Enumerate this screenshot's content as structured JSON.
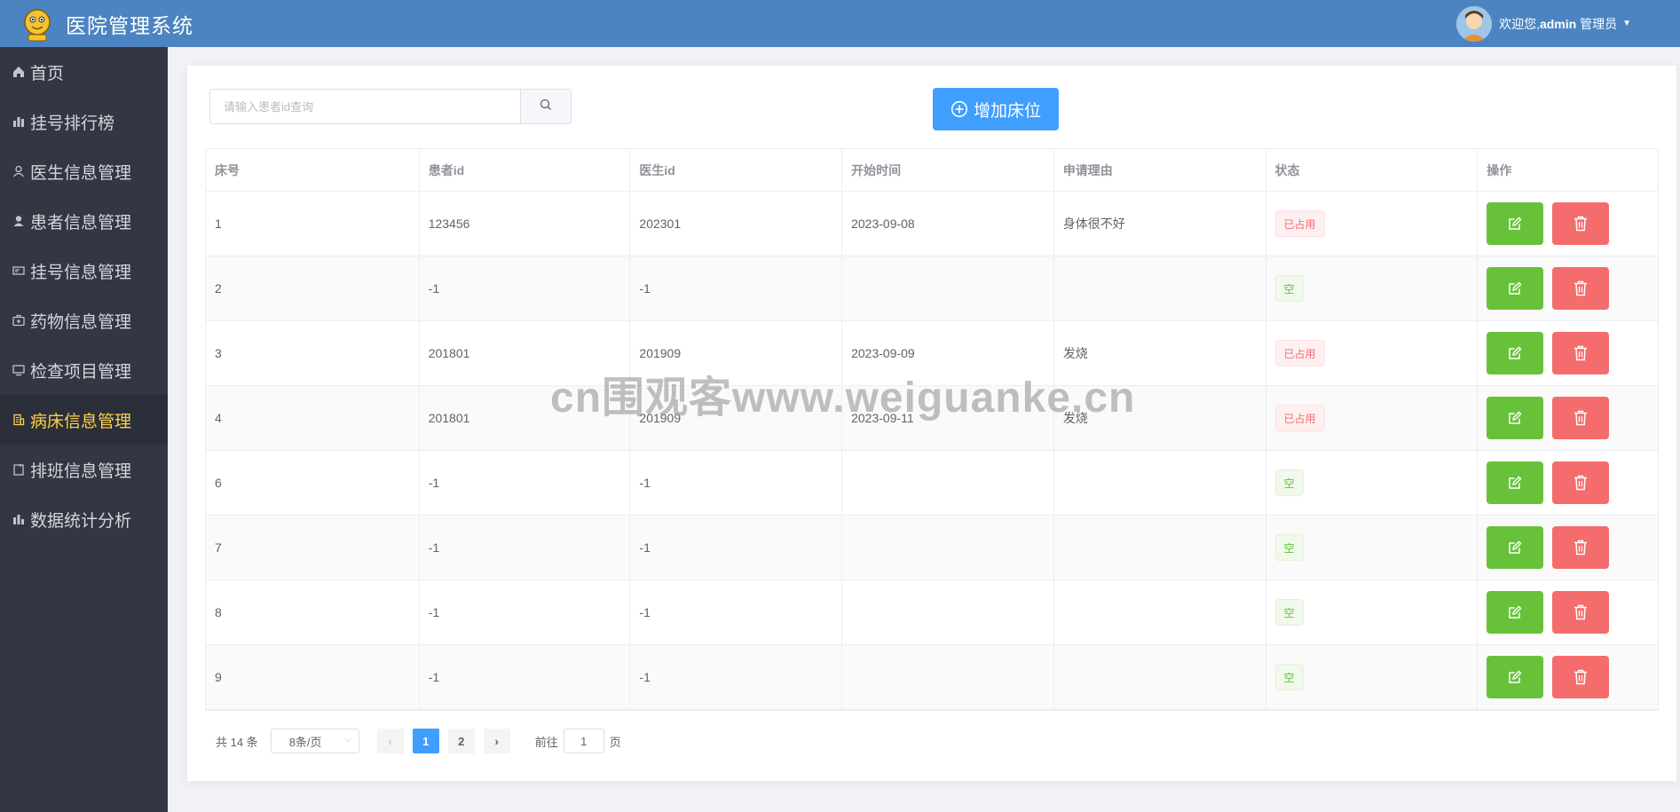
{
  "header": {
    "title": "医院管理系统",
    "welcome_prefix": "欢迎您,",
    "username": "admin",
    "role": "管理员"
  },
  "sidebar": {
    "items": [
      {
        "label": "首页",
        "icon": "home-icon",
        "active": false
      },
      {
        "label": "挂号排行榜",
        "icon": "bar-chart-icon",
        "active": false
      },
      {
        "label": "医生信息管理",
        "icon": "user-outline-icon",
        "active": false
      },
      {
        "label": "患者信息管理",
        "icon": "user-solid-icon",
        "active": false
      },
      {
        "label": "挂号信息管理",
        "icon": "ticket-icon",
        "active": false
      },
      {
        "label": "药物信息管理",
        "icon": "first-aid-icon",
        "active": false
      },
      {
        "label": "检查项目管理",
        "icon": "monitor-icon",
        "active": false
      },
      {
        "label": "病床信息管理",
        "icon": "office-building-icon",
        "active": true
      },
      {
        "label": "排班信息管理",
        "icon": "notebook-icon",
        "active": false
      },
      {
        "label": "数据统计分析",
        "icon": "stats-icon",
        "active": false
      }
    ]
  },
  "search": {
    "placeholder": "请输入患者id查询"
  },
  "add_button": {
    "label": "增加床位"
  },
  "table": {
    "headers": [
      "床号",
      "患者id",
      "医生id",
      "开始时间",
      "申请理由",
      "状态",
      "操作"
    ],
    "rows": [
      {
        "bed": "1",
        "patient_id": "123456",
        "doctor_id": "202301",
        "start": "2023-09-08",
        "reason": "身体很不好",
        "status": "已占用",
        "status_type": "danger"
      },
      {
        "bed": "2",
        "patient_id": "-1",
        "doctor_id": "-1",
        "start": "",
        "reason": "",
        "status": "空",
        "status_type": "success"
      },
      {
        "bed": "3",
        "patient_id": "201801",
        "doctor_id": "201909",
        "start": "2023-09-09",
        "reason": "发烧",
        "status": "已占用",
        "status_type": "danger"
      },
      {
        "bed": "4",
        "patient_id": "201801",
        "doctor_id": "201909",
        "start": "2023-09-11",
        "reason": "发烧",
        "status": "已占用",
        "status_type": "danger"
      },
      {
        "bed": "6",
        "patient_id": "-1",
        "doctor_id": "-1",
        "start": "",
        "reason": "",
        "status": "空",
        "status_type": "success"
      },
      {
        "bed": "7",
        "patient_id": "-1",
        "doctor_id": "-1",
        "start": "",
        "reason": "",
        "status": "空",
        "status_type": "success"
      },
      {
        "bed": "8",
        "patient_id": "-1",
        "doctor_id": "-1",
        "start": "",
        "reason": "",
        "status": "空",
        "status_type": "success"
      },
      {
        "bed": "9",
        "patient_id": "-1",
        "doctor_id": "-1",
        "start": "",
        "reason": "",
        "status": "空",
        "status_type": "success"
      }
    ]
  },
  "pagination": {
    "total_text": "共 14 条",
    "page_size": "8条/页",
    "pages": [
      "1",
      "2"
    ],
    "current_page": "1",
    "goto_label": "前往",
    "goto_value": "1",
    "goto_suffix": "页"
  },
  "watermark": "cn围观客www.weiguanke.cn",
  "colors": {
    "header_bg": "#4b84c0",
    "sidebar_bg": "#333744",
    "active_menu": "#ffd04b",
    "primary": "#409eff",
    "success": "#67c23a",
    "danger": "#f56c6c"
  }
}
